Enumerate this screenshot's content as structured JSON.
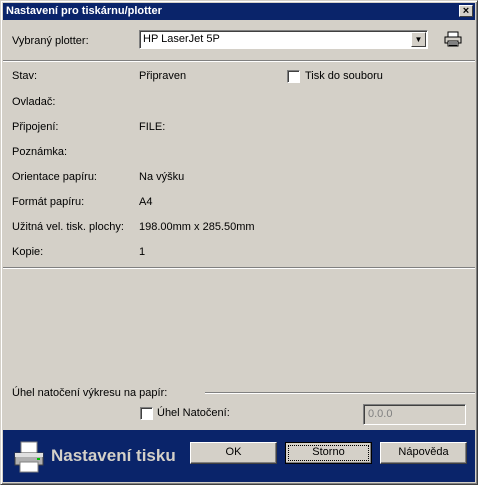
{
  "window": {
    "title": "Nastavení pro tiskárnu/plotter",
    "close": "×"
  },
  "plotter": {
    "label": "Vybraný plotter:",
    "selected": "HP LaserJet 5P"
  },
  "info": {
    "stav_label": "Stav:",
    "stav_value": "Připraven",
    "ovladac_label": "Ovladač:",
    "pripojeni_label": "Připojení:",
    "pripojeni_value": "FILE:",
    "poznamka_label": "Poznámka:",
    "orientace_label": "Orientace papíru:",
    "orientace_value": "Na výšku",
    "format_label": "Formát papíru:",
    "format_value": "A4",
    "uzitna_label": "Užitná vel. tisk. plochy:",
    "uzitna_value": "198.00mm x 285.50mm",
    "kopie_label": "Kopie:",
    "kopie_value": "1"
  },
  "print_to_file": {
    "label": "Tisk do souboru",
    "checked": false
  },
  "rotation": {
    "group_label": "Úhel natočení výkresu na papír:",
    "checkbox_label": "Úhel Natočení:",
    "checked": false,
    "value": "0.0.0"
  },
  "footer": {
    "caption": "Nastavení tisku",
    "ok": "OK",
    "cancel": "Storno",
    "help": "Nápověda"
  },
  "colors": {
    "title_bar": "#0a246a",
    "face": "#d4d0c8",
    "footer": "#0a246a"
  }
}
